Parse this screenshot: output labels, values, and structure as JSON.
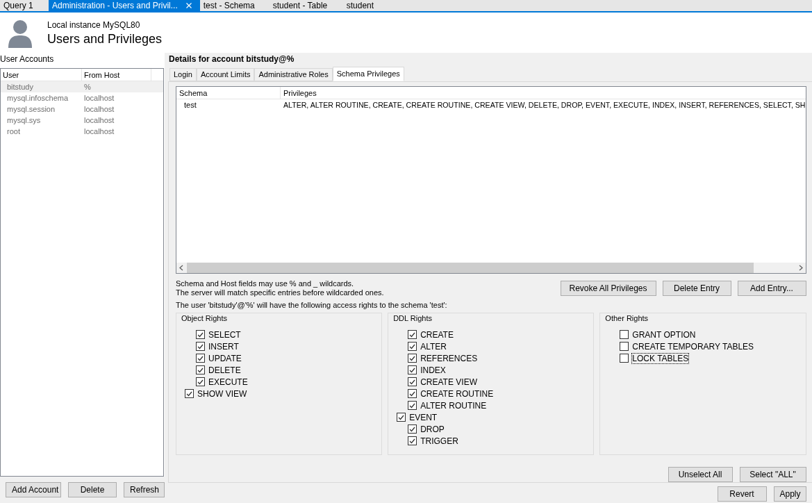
{
  "doc_tabs": [
    {
      "label": "Query 1",
      "selected": false,
      "closable": false
    },
    {
      "label": "Administration - Users and Privil...",
      "selected": true,
      "closable": true
    },
    {
      "label": "test - Schema",
      "selected": false,
      "closable": false
    },
    {
      "label": "student - Table",
      "selected": false,
      "closable": false
    },
    {
      "label": "student",
      "selected": false,
      "closable": false
    }
  ],
  "header": {
    "instance": "Local instance MySQL80",
    "title": "Users and Privileges"
  },
  "accounts": {
    "label": "User Accounts",
    "columns": [
      "User",
      "From Host"
    ],
    "rows": [
      {
        "user": "bitstudy",
        "host": "%",
        "selected": true
      },
      {
        "user": "mysql.infoschema",
        "host": "localhost",
        "selected": false
      },
      {
        "user": "mysql.session",
        "host": "localhost",
        "selected": false
      },
      {
        "user": "mysql.sys",
        "host": "localhost",
        "selected": false
      },
      {
        "user": "root",
        "host": "localhost",
        "selected": false
      }
    ],
    "buttons": [
      "Add Account",
      "Delete",
      "Refresh"
    ]
  },
  "details": {
    "title": "Details for account bitstudy@%",
    "tabs": [
      {
        "label": "Login",
        "selected": false
      },
      {
        "label": "Account Limits",
        "selected": false
      },
      {
        "label": "Administrative Roles",
        "selected": false
      },
      {
        "label": "Schema Privileges",
        "selected": true
      }
    ],
    "grid": {
      "columns": [
        "Schema",
        "Privileges"
      ],
      "rows": [
        {
          "schema": "test",
          "privileges": "ALTER, ALTER ROUTINE, CREATE, CREATE ROUTINE, CREATE VIEW, DELETE, DROP, EVENT, EXECUTE, INDEX, INSERT, REFERENCES, SELECT, SH"
        }
      ]
    },
    "notes": [
      "Schema and Host fields may use % and _ wildcards.",
      "The server will match specific entries before wildcarded ones."
    ],
    "entry_buttons": [
      "Revoke All Privileges",
      "Delete Entry",
      "Add Entry..."
    ],
    "rights_caption": "The user 'bitstudy'@'%' will have the following access rights to the schema 'test':",
    "groups": [
      {
        "title": "Object Rights",
        "items": [
          {
            "label": "SELECT",
            "checked": true,
            "kind": "inner",
            "focused": false
          },
          {
            "label": "INSERT",
            "checked": true,
            "kind": "inner",
            "focused": false
          },
          {
            "label": "UPDATE",
            "checked": true,
            "kind": "inner",
            "focused": false
          },
          {
            "label": "DELETE",
            "checked": true,
            "kind": "inner",
            "focused": false
          },
          {
            "label": "EXECUTE",
            "checked": true,
            "kind": "inner",
            "focused": false
          },
          {
            "label": "SHOW VIEW",
            "checked": true,
            "kind": "outer",
            "focused": false
          }
        ]
      },
      {
        "title": "DDL Rights",
        "items": [
          {
            "label": "CREATE",
            "checked": true,
            "kind": "inner",
            "focused": false
          },
          {
            "label": "ALTER",
            "checked": true,
            "kind": "inner",
            "focused": false
          },
          {
            "label": "REFERENCES",
            "checked": true,
            "kind": "inner",
            "focused": false
          },
          {
            "label": "INDEX",
            "checked": true,
            "kind": "inner",
            "focused": false
          },
          {
            "label": "CREATE VIEW",
            "checked": true,
            "kind": "inner",
            "focused": false
          },
          {
            "label": "CREATE ROUTINE",
            "checked": true,
            "kind": "inner",
            "focused": false
          },
          {
            "label": "ALTER ROUTINE",
            "checked": true,
            "kind": "inner",
            "focused": false
          },
          {
            "label": "EVENT",
            "checked": true,
            "kind": "outer",
            "focused": false
          },
          {
            "label": "DROP",
            "checked": true,
            "kind": "inner",
            "focused": false
          },
          {
            "label": "TRIGGER",
            "checked": true,
            "kind": "inner",
            "focused": false
          }
        ]
      },
      {
        "title": "Other Rights",
        "items": [
          {
            "label": "GRANT OPTION",
            "checked": false,
            "kind": "inner",
            "focused": false
          },
          {
            "label": "CREATE TEMPORARY TABLES",
            "checked": false,
            "kind": "inner",
            "focused": false
          },
          {
            "label": "LOCK TABLES",
            "checked": false,
            "kind": "inner",
            "focused": true
          }
        ]
      }
    ],
    "select_buttons": [
      "Unselect All",
      "Select \"ALL\""
    ]
  },
  "footer_buttons": [
    "Revert",
    "Apply"
  ]
}
